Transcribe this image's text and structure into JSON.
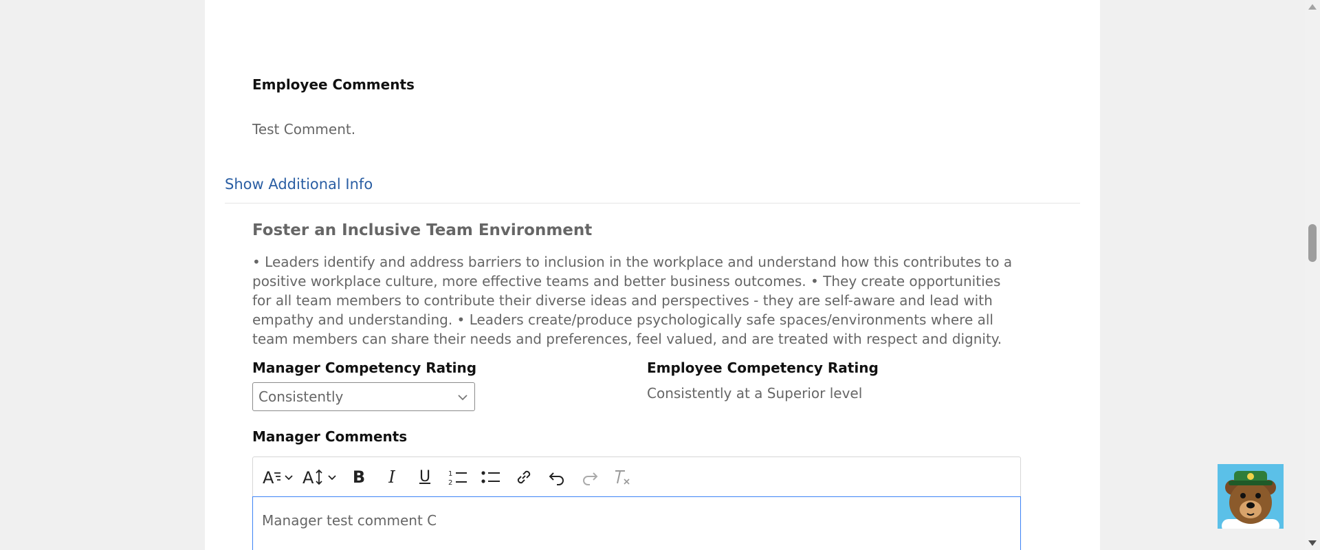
{
  "employee_comments": {
    "heading": "Employee Comments",
    "text": "Test Comment."
  },
  "show_additional_info": "Show Additional Info",
  "competency": {
    "title": "Foster an Inclusive Team Environment",
    "description": "• Leaders identify and address barriers to inclusion in the workplace and understand how this contributes to a positive workplace culture, more effective teams and better business outcomes. • They create opportunities for all team members to contribute their diverse ideas and perspectives - they are self-aware and lead with empathy and understanding. • Leaders create/produce psychologically safe spaces/environments where all team members can share their needs and preferences, feel valued, and are treated with respect and dignity."
  },
  "manager_rating": {
    "label": "Manager Competency Rating",
    "selected": "Consistently"
  },
  "employee_rating": {
    "label": "Employee Competency Rating",
    "value": "Consistently at a Superior level"
  },
  "manager_comments": {
    "label": "Manager Comments",
    "value": "Manager test comment C"
  },
  "toolbar": {
    "icons": [
      "font-family-icon",
      "font-size-icon",
      "bold-icon",
      "italic-icon",
      "underline-icon",
      "ordered-list-icon",
      "bullet-list-icon",
      "link-icon",
      "undo-icon",
      "redo-icon",
      "clear-format-icon"
    ],
    "bold_glyph": "B",
    "italic_glyph": "I",
    "underline_glyph": "U"
  },
  "colors": {
    "link": "#2a5ea3",
    "focus_border": "#3b82f6",
    "mascot_bg": "#5bc0e8"
  }
}
